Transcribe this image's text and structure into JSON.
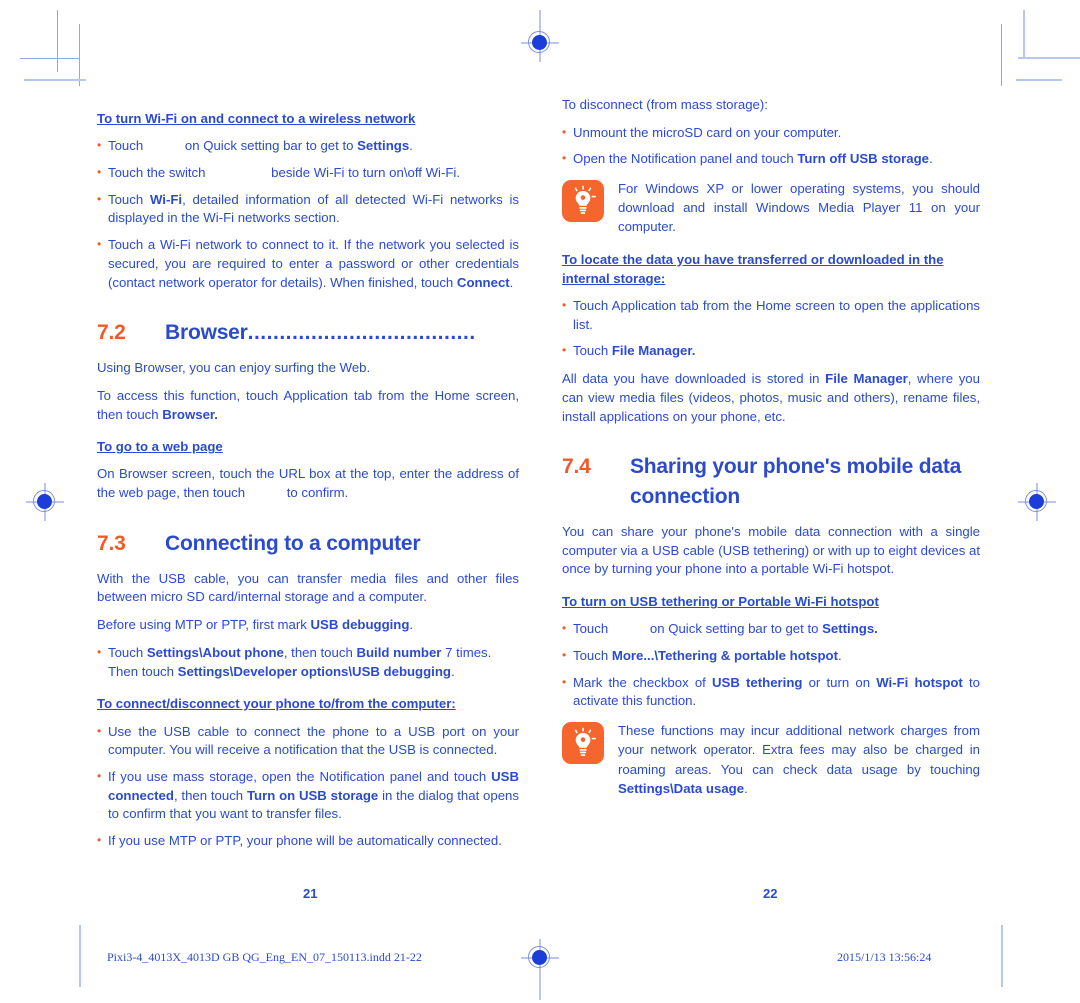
{
  "document": {
    "title": "Alcatel Pixi 3 Quick Guide pages 21-22",
    "text_color": "#2b4bcf",
    "accent_color": "#f05a28"
  },
  "left_page": {
    "page_number": "21",
    "heading_wifi": "To turn Wi-Fi on and connect to a wireless network",
    "bullets_wifi": [
      {
        "parts": [
          {
            "t": "Touch",
            "b": false
          },
          {
            "t": "__ICON__",
            "b": false
          },
          {
            "t": " on Quick setting bar to get to ",
            "b": false
          },
          {
            "t": "Settings",
            "b": true
          },
          {
            "t": ".",
            "b": false
          }
        ]
      },
      {
        "parts": [
          {
            "t": "Touch the switch",
            "b": false
          },
          {
            "t": "__ICON_LG__",
            "b": false
          },
          {
            "t": " beside Wi-Fi to turn on\\off Wi-Fi.",
            "b": false
          }
        ]
      },
      {
        "parts": [
          {
            "t": "Touch ",
            "b": false
          },
          {
            "t": "Wi-Fi",
            "b": true
          },
          {
            "t": ", detailed information of all detected Wi-Fi networks is displayed in the Wi-Fi networks section.",
            "b": false
          }
        ]
      },
      {
        "parts": [
          {
            "t": "Touch a Wi-Fi network to connect to it. If the network you selected is secured, you are required to enter a password or other credentials (contact network operator for details). When finished, touch ",
            "b": false
          },
          {
            "t": "Connect",
            "b": true
          },
          {
            "t": ".",
            "b": false
          }
        ]
      }
    ],
    "section_7_2": {
      "number": "7.2",
      "title": "Browser",
      "dots": "....................................",
      "p1": "Using Browser, you can enjoy surfing the Web.",
      "p2_parts": [
        {
          "t": "To access this function, touch Application tab from the Home screen, then touch ",
          "b": false
        },
        {
          "t": "Browser.",
          "b": true
        }
      ],
      "heading_webpage": "To go to a web page",
      "p3_parts": [
        {
          "t": "On Browser screen, touch the URL box at the top, enter the address of the web page, then touch",
          "b": false
        },
        {
          "t": "__ICON__",
          "b": false
        },
        {
          "t": " to confirm.",
          "b": false
        }
      ]
    },
    "section_7_3": {
      "number": "7.3",
      "title": "Connecting to a computer",
      "p1": "With the USB cable, you can transfer media files and other files between micro SD card/internal storage and a computer.",
      "p2_parts": [
        {
          "t": "Before using MTP or PTP, first mark ",
          "b": false
        },
        {
          "t": "USB debugging",
          "b": true
        },
        {
          "t": ".",
          "b": false
        }
      ],
      "bullet_debug_parts": [
        {
          "t": "Touch ",
          "b": false
        },
        {
          "t": "Settings\\About phone",
          "b": true
        },
        {
          "t": ", then touch ",
          "b": false
        },
        {
          "t": "Build number",
          "b": true
        },
        {
          "t": " 7 times. Then touch ",
          "b": false
        },
        {
          "t": "Settings\\Developer options\\USB debugging",
          "b": true
        },
        {
          "t": ".",
          "b": false
        }
      ],
      "heading_connect": "To connect/disconnect your phone to/from the computer:",
      "bullets_connect": [
        {
          "parts": [
            {
              "t": "Use the USB cable to connect the phone to a USB port on your computer. You will receive a notification that the USB is connected.",
              "b": false
            }
          ]
        },
        {
          "parts": [
            {
              "t": "If you use mass storage, open the Notification panel and touch ",
              "b": false
            },
            {
              "t": "USB connected",
              "b": true
            },
            {
              "t": ", then touch ",
              "b": false
            },
            {
              "t": "Turn on USB storage",
              "b": true
            },
            {
              "t": " in the dialog that opens to confirm that you want to transfer files.",
              "b": false
            }
          ]
        },
        {
          "parts": [
            {
              "t": "If you use MTP or PTP, your phone will be automatically connected.",
              "b": false
            }
          ]
        }
      ]
    }
  },
  "right_page": {
    "page_number": "22",
    "p_disconnect": "To disconnect (from mass storage):",
    "bullets_disconnect": [
      {
        "parts": [
          {
            "t": "Unmount the microSD card on your computer.",
            "b": false
          }
        ]
      },
      {
        "parts": [
          {
            "t": "Open the Notification panel and touch ",
            "b": false
          },
          {
            "t": "Turn off USB storage",
            "b": true
          },
          {
            "t": ".",
            "b": false
          }
        ]
      }
    ],
    "tip_1": "For Windows XP or lower operating systems, you should download and install Windows Media Player 11 on your computer.",
    "heading_locate": "To locate the data you have transferred or downloaded in the internal storage:",
    "bullets_locate": [
      {
        "parts": [
          {
            "t": "Touch Application tab from the Home screen to open the applications list.",
            "b": false
          }
        ]
      },
      {
        "parts": [
          {
            "t": "Touch ",
            "b": false
          },
          {
            "t": "File Manager.",
            "b": true
          }
        ]
      }
    ],
    "p_alldata_parts": [
      {
        "t": "All data you have downloaded is stored in ",
        "b": false
      },
      {
        "t": "File Manager",
        "b": true
      },
      {
        "t": ", where you can view media files (videos, photos, music and others), rename files, install applications on your phone, etc.",
        "b": false
      }
    ],
    "section_7_4": {
      "number": "7.4",
      "title_line1": "Sharing your phone's mobile data",
      "title_line2": "connection",
      "p1": "You can share your phone's mobile data connection with a single computer via a USB cable (USB tethering) or with up to eight devices at once by turning your phone into a portable Wi-Fi hotspot.",
      "heading_tether": "To turn on USB tethering or Portable Wi-Fi hotspot",
      "bullets_tether": [
        {
          "parts": [
            {
              "t": "Touch",
              "b": false
            },
            {
              "t": "__ICON__",
              "b": false
            },
            {
              "t": " on Quick setting bar to get to ",
              "b": false
            },
            {
              "t": "Settings.",
              "b": true
            }
          ]
        },
        {
          "parts": [
            {
              "t": "Touch ",
              "b": false
            },
            {
              "t": "More...\\Tethering & portable hotspot",
              "b": true
            },
            {
              "t": ".",
              "b": false
            }
          ]
        },
        {
          "parts": [
            {
              "t": "Mark the checkbox of ",
              "b": false
            },
            {
              "t": "USB tethering",
              "b": true
            },
            {
              "t": " or turn on ",
              "b": false
            },
            {
              "t": "Wi-Fi hotspot",
              "b": true
            },
            {
              "t": " to activate this function.",
              "b": false
            }
          ]
        }
      ],
      "tip_2_parts": [
        {
          "t": "These functions may incur additional network charges from your network operator. Extra fees may also be charged in roaming areas. You can check data usage by touching ",
          "b": false
        },
        {
          "t": "Settings\\Data usage",
          "b": true
        },
        {
          "t": ".",
          "b": false
        }
      ]
    }
  },
  "footer": {
    "filename": "Pixi3-4_4013X_4013D GB QG_Eng_EN_07_150113.indd   21-22",
    "timestamp": "2015/1/13   13:56:24"
  }
}
